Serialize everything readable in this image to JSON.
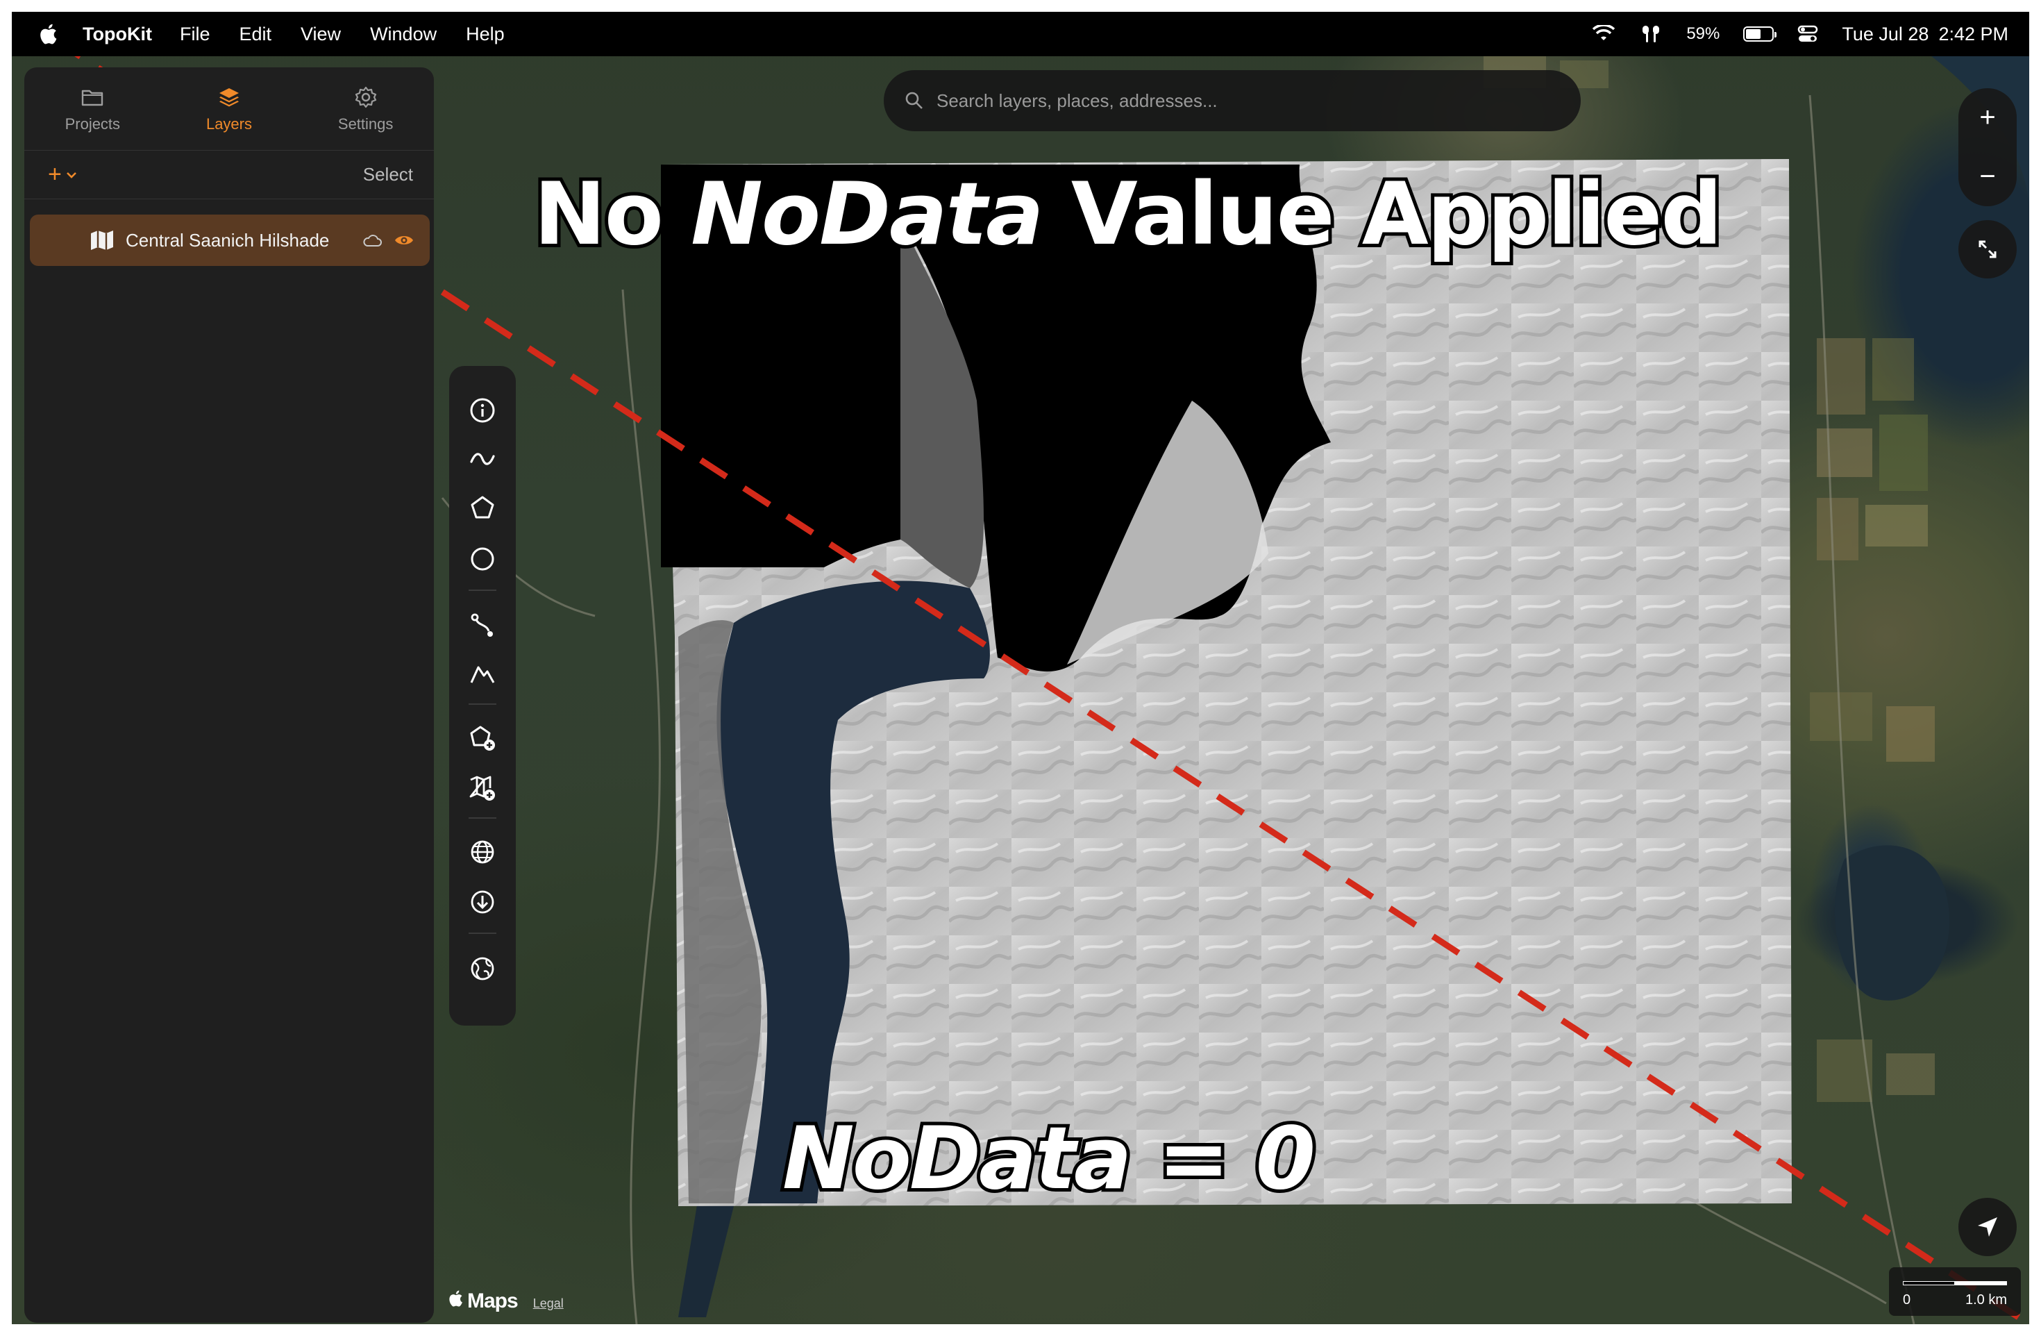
{
  "menubar": {
    "app_name": "TopoKit",
    "menus": [
      "File",
      "Edit",
      "View",
      "Window",
      "Help"
    ],
    "battery_percent": "59%",
    "battery_level": 0.59,
    "date": "Tue Jul 28",
    "time": "2:42 PM"
  },
  "sidebar": {
    "tabs": [
      {
        "label": "Projects",
        "icon": "folder-icon"
      },
      {
        "label": "Layers",
        "icon": "layers-icon",
        "active": true
      },
      {
        "label": "Settings",
        "icon": "gear-icon"
      }
    ],
    "add_label": "+",
    "select_label": "Select",
    "layers": [
      {
        "name": "Central Saanich Hilshade",
        "icon": "map-icon",
        "visible": true
      }
    ]
  },
  "search": {
    "placeholder": "Search layers, places, addresses..."
  },
  "tools": [
    "info-icon",
    "freehand-line-icon",
    "polygon-icon",
    "circle-icon",
    "route-icon",
    "elevation-profile-icon",
    "add-shape-icon",
    "add-map-icon",
    "globe-icon",
    "download-icon",
    "basemap-icon"
  ],
  "map_controls": {
    "zoom_in": "+",
    "zoom_out": "−",
    "fit_icon": "expand-icon",
    "locate_icon": "location-arrow-icon"
  },
  "overlay": {
    "title_prefix": "No ",
    "title_italic": "NoData",
    "title_suffix": " Value Applied",
    "bottom_label": "NoData = 0"
  },
  "attribution": {
    "brand": "Maps",
    "legal": "Legal"
  },
  "scale": {
    "start": "0",
    "end": "1.0 km"
  },
  "colors": {
    "accent": "#f08a2a",
    "selected_layer_bg": "#5a3a22",
    "dash_line": "#d42a1a"
  }
}
